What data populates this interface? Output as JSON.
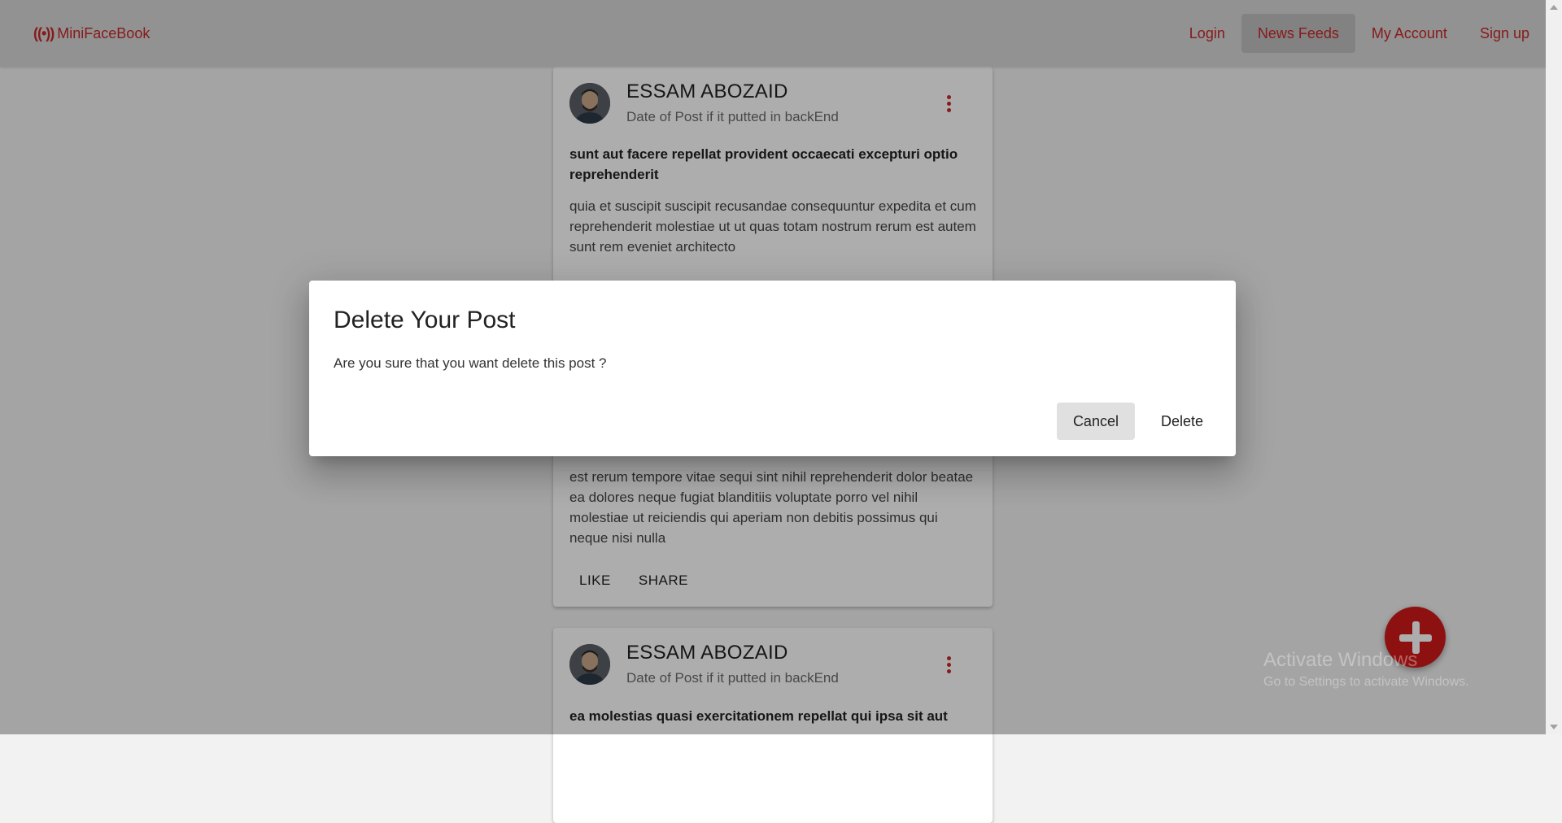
{
  "navbar": {
    "brand": "MiniFaceBook",
    "brand_icon": "broadcast-icon",
    "links": [
      "Login",
      "News Feeds",
      "My Account",
      "Sign up"
    ],
    "active_link": "News Feeds",
    "accent_color": "#c62828"
  },
  "posts": [
    {
      "author": "ESSAM ABOZAID",
      "date": "Date of Post if it putted in backEnd",
      "title": "sunt aut facere repellat provident occaecati excepturi optio reprehenderit",
      "body": "quia et suscipit suscipit recusandae consequuntur expedita et cum reprehenderit molestiae ut ut quas totam nostrum rerum est autem sunt rem eveniet architecto",
      "body_lower": "est rerum tempore vitae sequi sint nihil reprehenderit dolor beatae ea dolores neque fugiat blanditiis voluptate porro vel nihil molestiae ut reiciendis qui aperiam non debitis possimus qui neque nisi nulla",
      "like_label": "LIKE",
      "share_label": "SHARE"
    },
    {
      "author": "ESSAM ABOZAID",
      "date": "Date of Post if it putted in backEnd",
      "title": "ea molestias quasi exercitationem repellat qui ipsa sit aut"
    }
  ],
  "dialog": {
    "title": "Delete Your Post",
    "message": "Are you sure that you want delete this post ?",
    "cancel_label": "Cancel",
    "delete_label": "Delete"
  },
  "fab": {
    "icon": "plus-icon",
    "color": "#d11a1a"
  },
  "watermark": {
    "line1": "Activate Windows",
    "line2": "Go to Settings to activate Windows."
  }
}
